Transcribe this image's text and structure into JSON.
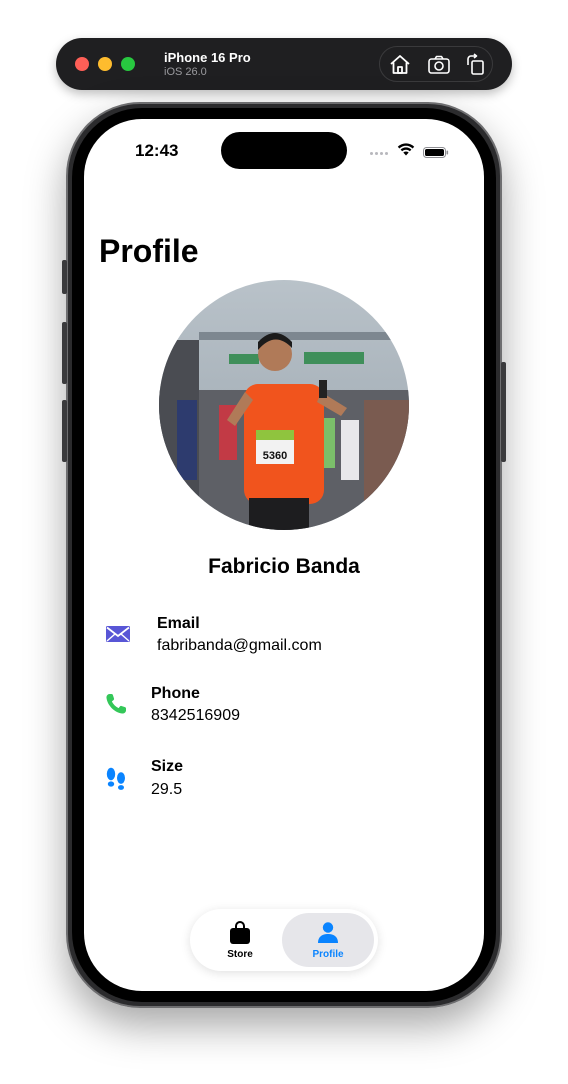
{
  "simulator": {
    "device_name": "iPhone 16 Pro",
    "os_version": "iOS 26.0",
    "tools": [
      "home-icon",
      "screenshot-icon",
      "rotate-icon"
    ]
  },
  "status_bar": {
    "time": "12:43"
  },
  "page": {
    "title": "Profile"
  },
  "profile": {
    "name": "Fabricio Banda",
    "photo_bib_number": "5360",
    "fields": [
      {
        "icon": "envelope-icon",
        "label": "Email",
        "value": "fabribanda@gmail.com",
        "color": "#5856d6"
      },
      {
        "icon": "phone-icon",
        "label": "Phone",
        "value": "8342516909",
        "color": "#34c759"
      },
      {
        "icon": "footprints-icon",
        "label": "Size",
        "value": "29.5",
        "color": "#0a84ff"
      }
    ]
  },
  "tab_bar": {
    "tabs": [
      {
        "icon": "bag-icon",
        "label": "Store",
        "selected": false
      },
      {
        "icon": "person-icon",
        "label": "Profile",
        "selected": true
      }
    ],
    "selected_color": "#0a84ff"
  }
}
